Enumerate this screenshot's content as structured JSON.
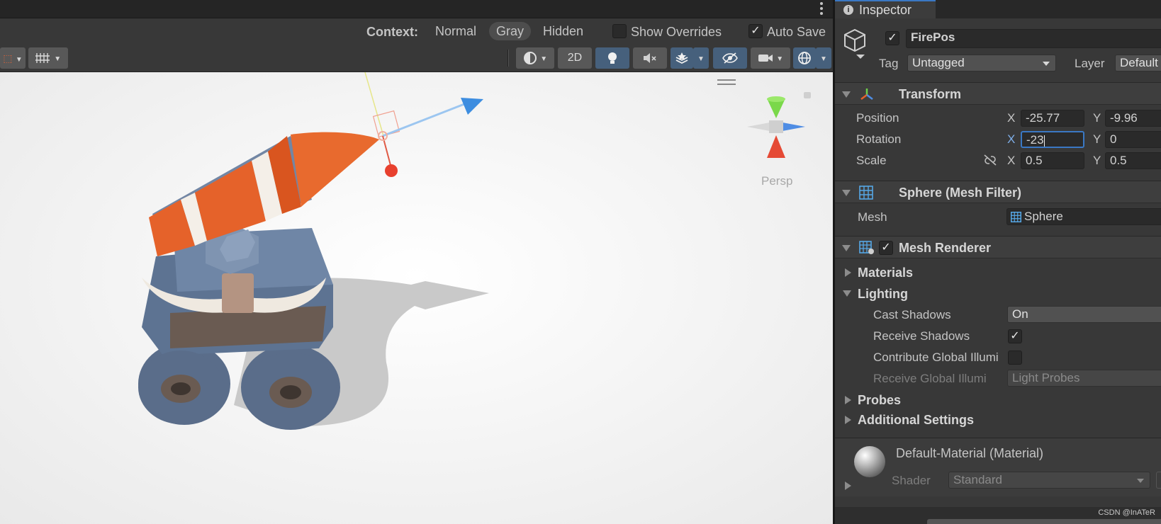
{
  "scene": {
    "context": {
      "label": "Context:",
      "options": [
        "Normal",
        "Gray",
        "Hidden"
      ],
      "selected": "Gray"
    },
    "show_overrides": {
      "label": "Show Overrides",
      "checked": false
    },
    "auto_save": {
      "label": "Auto Save",
      "checked": true
    },
    "toolbar": {
      "mode_2d_label": "2D"
    },
    "view_label": "Persp"
  },
  "inspector": {
    "tab_label": "Inspector",
    "object": {
      "active": true,
      "name": "FirePos",
      "tag_label": "Tag",
      "tag_value": "Untagged",
      "layer_label": "Layer",
      "layer_value": "Default"
    },
    "transform": {
      "title": "Transform",
      "position": {
        "label": "Position",
        "x": "-25.77",
        "y": "-9.96"
      },
      "rotation": {
        "label": "Rotation",
        "x": "-23",
        "y": "0"
      },
      "scale": {
        "label": "Scale",
        "x": "0.5",
        "y": "0.5"
      }
    },
    "mesh_filter": {
      "title": "Sphere (Mesh Filter)",
      "mesh_label": "Mesh",
      "mesh_value": "Sphere"
    },
    "mesh_renderer": {
      "title": "Mesh Renderer",
      "enabled": true,
      "materials_label": "Materials",
      "lighting_label": "Lighting",
      "cast_shadows_label": "Cast Shadows",
      "cast_shadows_value": "On",
      "receive_shadows_label": "Receive Shadows",
      "receive_shadows_checked": true,
      "contribute_gi_label": "Contribute Global Illumi",
      "contribute_gi_checked": false,
      "receive_gi_label": "Receive Global Illumi",
      "receive_gi_value": "Light Probes",
      "probes_label": "Probes",
      "additional_settings_label": "Additional Settings"
    },
    "material": {
      "name": "Default-Material (Material)",
      "shader_label": "Shader",
      "shader_value": "Standard"
    }
  },
  "watermark": "CSDN @InATeR",
  "colors": {
    "editor_bg": "#383838",
    "viewport_bg": "#f3f3f3",
    "selection_blue": "#3a78c4",
    "cannon_orange": "#e5622a",
    "cannon_blue": "#5d7392"
  }
}
